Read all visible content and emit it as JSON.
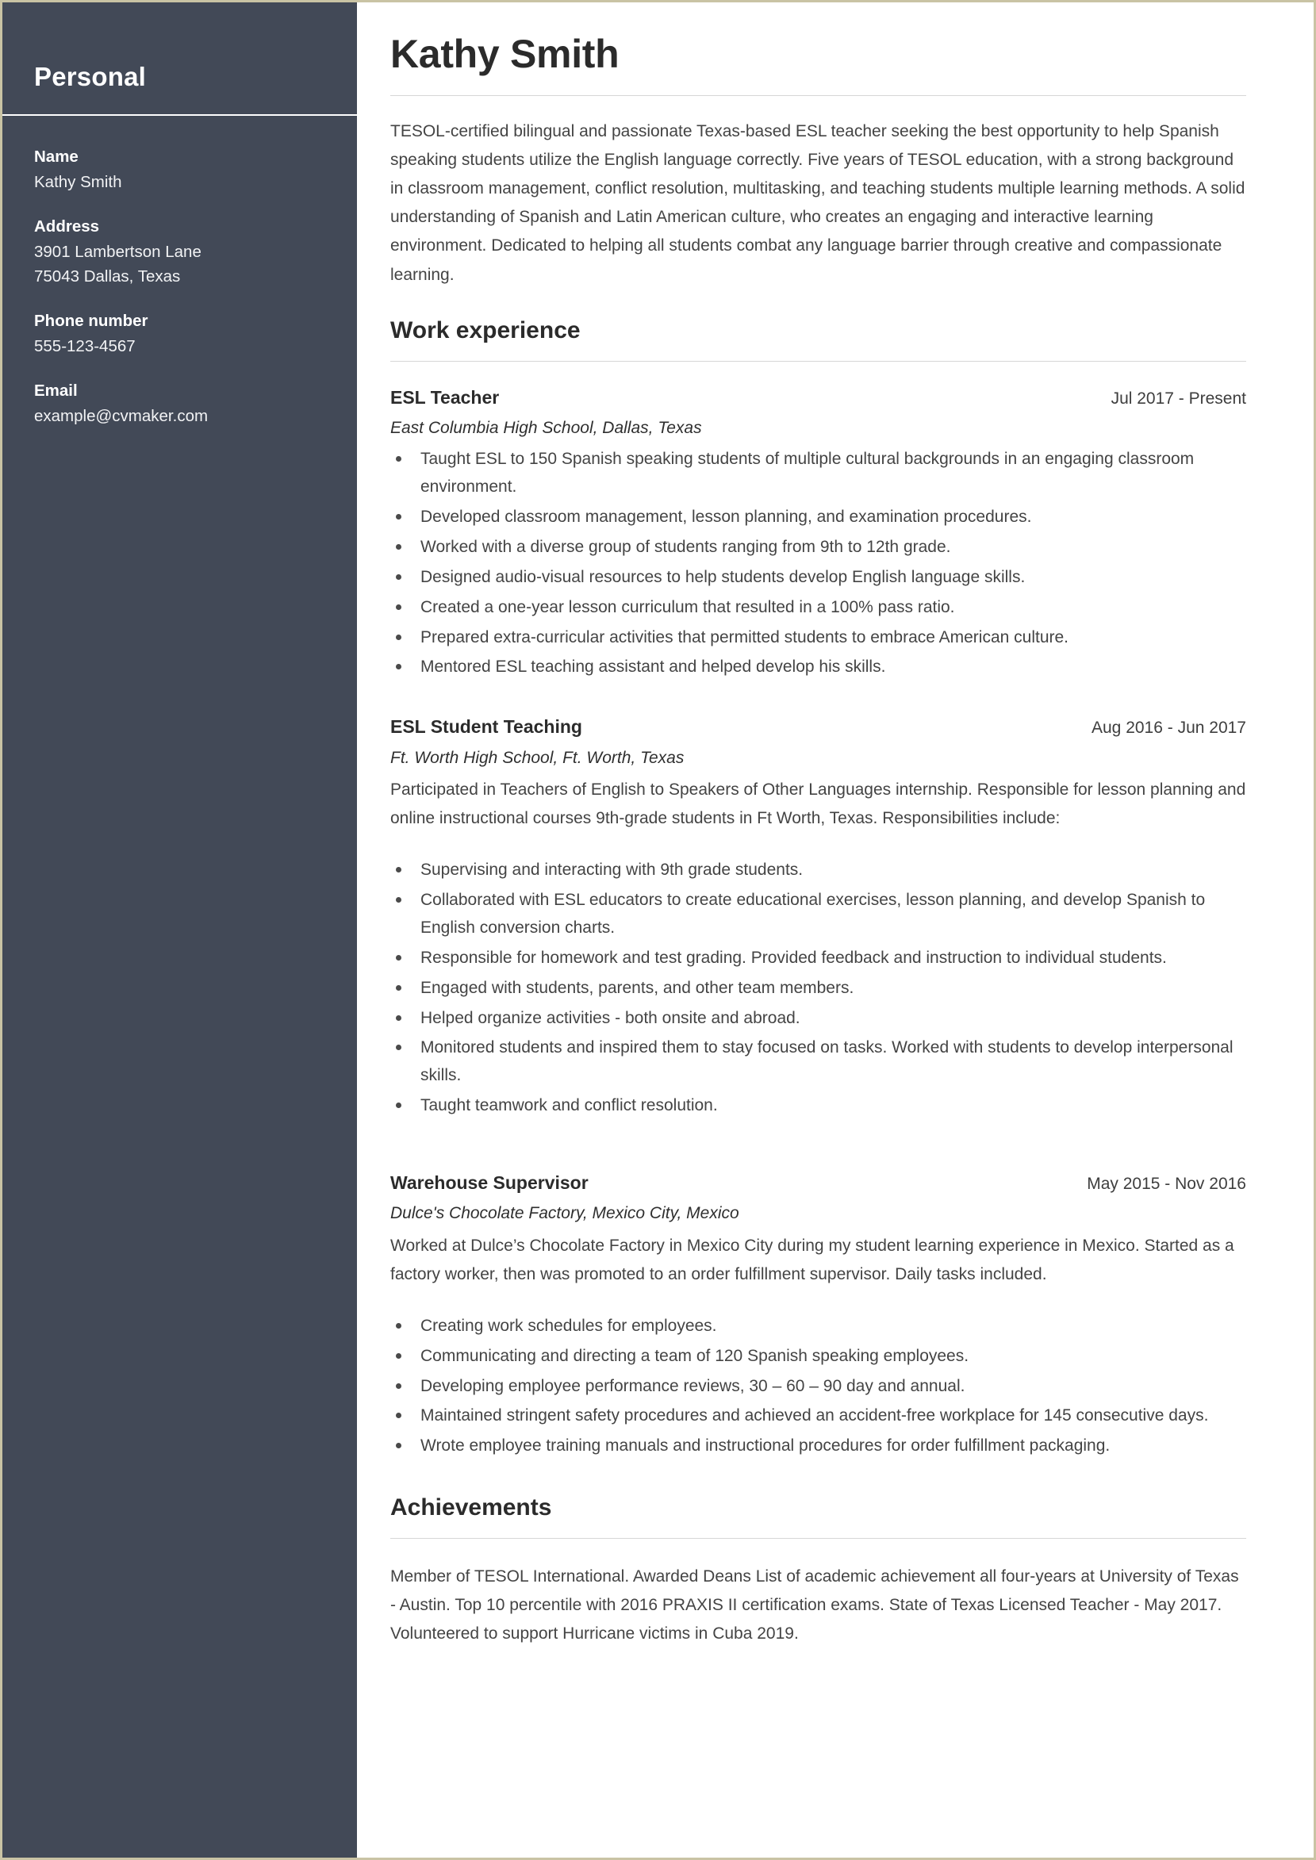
{
  "document": {
    "type": "resume",
    "accent_sidebar_color": "#424957",
    "page_border_color": "#c9c3a4",
    "rule_color": "#d7d7d7"
  },
  "sidebar": {
    "title": "Personal",
    "fields": [
      {
        "label": "Name",
        "lines": [
          "Kathy Smith"
        ]
      },
      {
        "label": "Address",
        "lines": [
          "3901 Lambertson Lane",
          "75043 Dallas, Texas"
        ]
      },
      {
        "label": "Phone number",
        "lines": [
          "555-123-4567"
        ]
      },
      {
        "label": "Email",
        "lines": [
          "example@cvmaker.com"
        ]
      }
    ]
  },
  "header": {
    "name": "Kathy Smith"
  },
  "summary": {
    "text": "TESOL-certified bilingual and passionate Texas-based ESL teacher seeking the best opportunity to help Spanish speaking students utilize the English language correctly. Five years of TESOL education, with a strong background in classroom management, conflict resolution, multitasking, and teaching students multiple learning methods. A solid understanding of Spanish and Latin American culture, who creates an engaging and interactive learning environment. Dedicated to helping all students combat any language barrier through creative and compassionate learning."
  },
  "work_experience": {
    "section_title": "Work experience",
    "jobs": [
      {
        "title": "ESL Teacher",
        "dates": "Jul 2017 - Present",
        "company": "East Columbia High School, Dallas, Texas",
        "intro": "",
        "bullets": [
          "Taught ESL to 150 Spanish speaking students of multiple cultural backgrounds in an engaging classroom environment.",
          "Developed classroom management, lesson planning, and examination procedures.",
          "Worked with a diverse group of students ranging from 9th to 12th grade.",
          "Designed audio-visual resources to help students develop English language skills.",
          "Created a one-year lesson curriculum that resulted in a 100% pass ratio.",
          "Prepared extra-curricular activities that permitted students to embrace American culture.",
          "Mentored ESL teaching assistant and helped develop his skills."
        ]
      },
      {
        "title": "ESL Student Teaching",
        "dates": "Aug 2016 - Jun 2017",
        "company": "Ft. Worth High School, Ft. Worth, Texas",
        "intro": "Participated in Teachers of English to Speakers of Other Languages internship. Responsible for lesson planning and online instructional courses 9th-grade students in Ft Worth, Texas. Responsibilities include:",
        "bullets": [
          "Supervising and interacting with 9th grade students.",
          "Collaborated with ESL educators to create educational exercises, lesson planning, and develop Spanish to English conversion charts.",
          "Responsible for homework and test grading. Provided feedback and instruction to individual students.",
          "Engaged with students, parents, and other team members.",
          "Helped organize activities - both onsite and abroad.",
          "Monitored students and inspired them to stay focused on tasks. Worked with students to develop interpersonal skills.",
          "Taught teamwork and conflict resolution."
        ]
      },
      {
        "title": "Warehouse Supervisor",
        "dates": "May 2015 - Nov 2016",
        "company": "Dulce's Chocolate Factory, Mexico City, Mexico",
        "intro": "Worked at Dulce’s Chocolate Factory in Mexico City during my student learning experience in Mexico. Started as a factory worker, then was promoted to an order fulfillment supervisor. Daily tasks included.",
        "bullets": [
          "Creating work schedules for employees.",
          "Communicating and directing a team of 120 Spanish speaking employees.",
          "Developing employee performance reviews, 30 – 60 – 90 day and annual.",
          "Maintained stringent safety procedures and achieved an accident-free workplace for 145 consecutive days.",
          "Wrote employee training manuals and instructional procedures for order fulfillment packaging."
        ]
      }
    ]
  },
  "achievements": {
    "section_title": "Achievements",
    "text": "Member of TESOL International. Awarded Deans List of academic achievement all four-years at University of Texas - Austin. Top 10 percentile with 2016 PRAXIS II certification exams. State of Texas Licensed Teacher - May 2017. Volunteered to support Hurricane victims in Cuba 2019."
  }
}
